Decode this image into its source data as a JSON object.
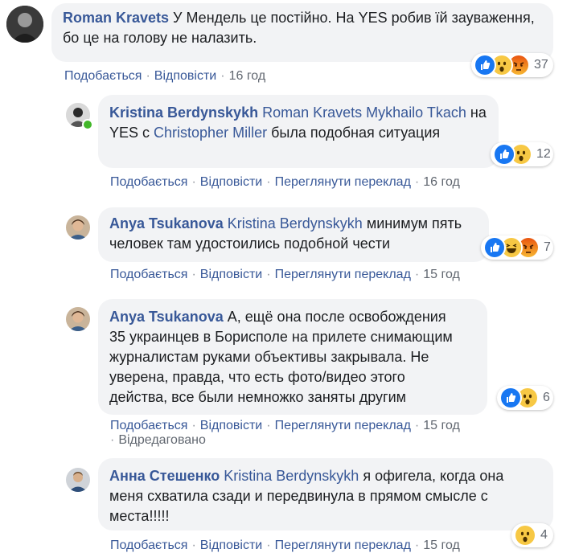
{
  "comments": [
    {
      "author": "Roman Kravets",
      "mentions": [],
      "text": " У Мендель це постійно. На YES робив їй зауваження, бо це на голову не налазить.",
      "actions": {
        "like": "Подобається",
        "reply": "Відповісти",
        "time": "16 год"
      },
      "reactions": {
        "types": [
          "like",
          "wow",
          "angry"
        ],
        "count": "37"
      }
    },
    {
      "author": "Kristina Berdynskykh",
      "mentions": [
        "Roman Kravets",
        "Mykhailo Tkach"
      ],
      "text_parts": [
        " на YES с ",
        " была подобная ситуация"
      ],
      "mention_inline": "Christopher Miller",
      "actions": {
        "like": "Подобається",
        "reply": "Відповісти",
        "translate": "Переглянути переклад",
        "time": "16 год"
      },
      "reactions": {
        "types": [
          "like",
          "wow"
        ],
        "count": "12"
      }
    },
    {
      "author": "Anya Tsukanova",
      "mentions": [
        "Kristina Berdynskykh"
      ],
      "text": " минимум пять человек там удостоились подобной чести",
      "actions": {
        "like": "Подобається",
        "reply": "Відповісти",
        "translate": "Переглянути переклад",
        "time": "15 год"
      },
      "reactions": {
        "types": [
          "like",
          "haha",
          "angry"
        ],
        "count": "7"
      }
    },
    {
      "author": "Anya Tsukanova",
      "mentions": [],
      "text": " А, ещё она после освобождения 35 украинцев в Борисполе на прилете снимающим журналистам руками объективы закрывала. Не уверена, правда, что есть фото/видео этого действа, все были немножко заняты другим",
      "actions": {
        "like": "Подобається",
        "reply": "Відповісти",
        "translate": "Переглянути переклад",
        "time": "15 год"
      },
      "edited": "Відредаговано",
      "reactions": {
        "types": [
          "like",
          "wow"
        ],
        "count": "6"
      }
    },
    {
      "author": "Анна Стешенко",
      "mentions": [
        "Kristina Berdynskykh"
      ],
      "text": " я офигела, когда она меня схватила сзади и передвинула в прямом смысле с места!!!!!",
      "actions": {
        "like": "Подобається",
        "reply": "Відповісти",
        "translate": "Переглянути переклад",
        "time": "15 год"
      },
      "reactions": {
        "types": [
          "wow"
        ],
        "count": "4"
      }
    }
  ],
  "colors": {
    "link": "#385898",
    "bubble": "#f2f3f5",
    "meta": "#616770",
    "like": "#1877f2",
    "wow": "#f7c844",
    "angry": "#e9710f"
  }
}
